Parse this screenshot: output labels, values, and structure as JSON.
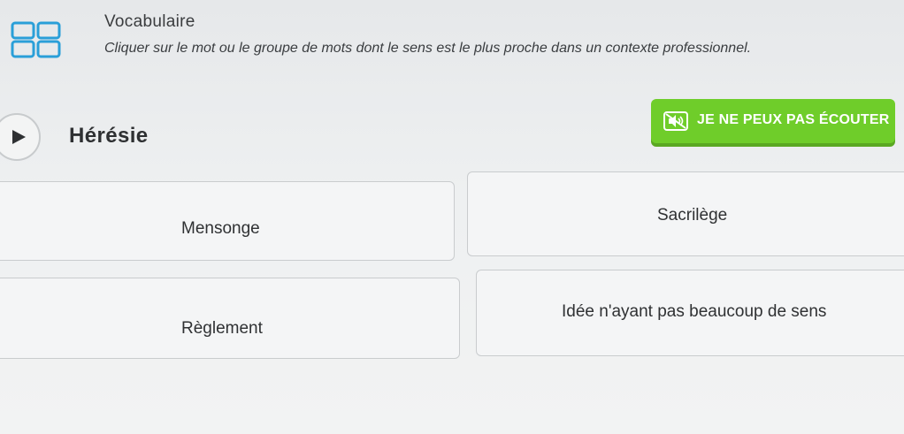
{
  "header": {
    "title": "Vocabulaire",
    "instruction": "Cliquer sur le mot ou le groupe de mots dont le sens est le plus proche dans un contexte professionnel."
  },
  "question": {
    "word": "Hérésie",
    "cant_listen_label": "JE NE PEUX PAS ÉCOUTER"
  },
  "options": [
    {
      "label": "Mensonge"
    },
    {
      "label": "Sacrilège"
    },
    {
      "label": "Règlement"
    },
    {
      "label": "Idée n'ayant pas beaucoup de sens"
    }
  ],
  "colors": {
    "accent": "#6fcd2a",
    "icon": "#2a9fd8"
  }
}
